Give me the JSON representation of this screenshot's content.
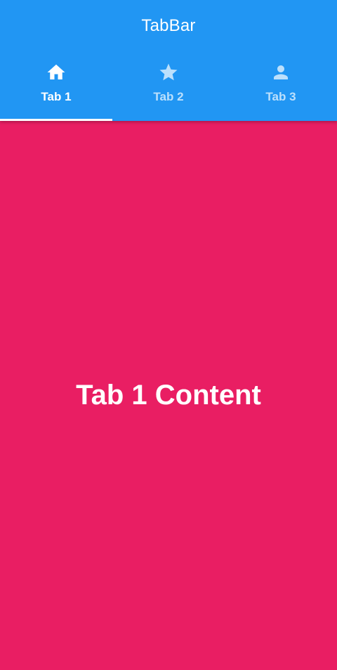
{
  "appbar": {
    "title": "TabBar",
    "background": "#2196F3"
  },
  "tabs": [
    {
      "label": "Tab 1",
      "icon": "home-icon",
      "selected": true
    },
    {
      "label": "Tab 2",
      "icon": "star-icon",
      "selected": false
    },
    {
      "label": "Tab 3",
      "icon": "person-icon",
      "selected": false
    }
  ],
  "content": {
    "text": "Tab 1 Content",
    "background": "#E91E63"
  }
}
